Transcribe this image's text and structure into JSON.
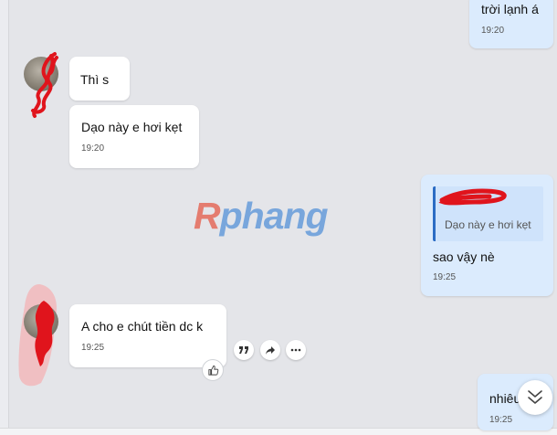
{
  "messages": {
    "top_right": {
      "text": "trời lạnh á",
      "time": "19:20"
    },
    "in_1": {
      "text": "Thì s"
    },
    "in_2": {
      "text": "Dạo này e hơi kẹt",
      "time": "19:20"
    },
    "out_reply": {
      "quoted_text": "Dạo này e hơi kẹt",
      "text": "sao vậy nè",
      "time": "19:25"
    },
    "in_3": {
      "text": "A cho e chút tiền dc k",
      "time": "19:25"
    },
    "out_bottom": {
      "text": "nhiêu",
      "time": "19:25"
    }
  },
  "watermark": {
    "first_letter": "R",
    "rest": "phang"
  },
  "icons": {
    "quote": "quote-icon",
    "forward": "forward-icon",
    "more": "more-icon",
    "like": "thumbs-up-icon",
    "scroll": "chevron-double-down-icon"
  },
  "colors": {
    "incoming_bubble": "#ffffff",
    "outgoing_bubble": "#dbebfd",
    "quote_bar": "#2b6cc4",
    "scribble": "#e0141c"
  }
}
